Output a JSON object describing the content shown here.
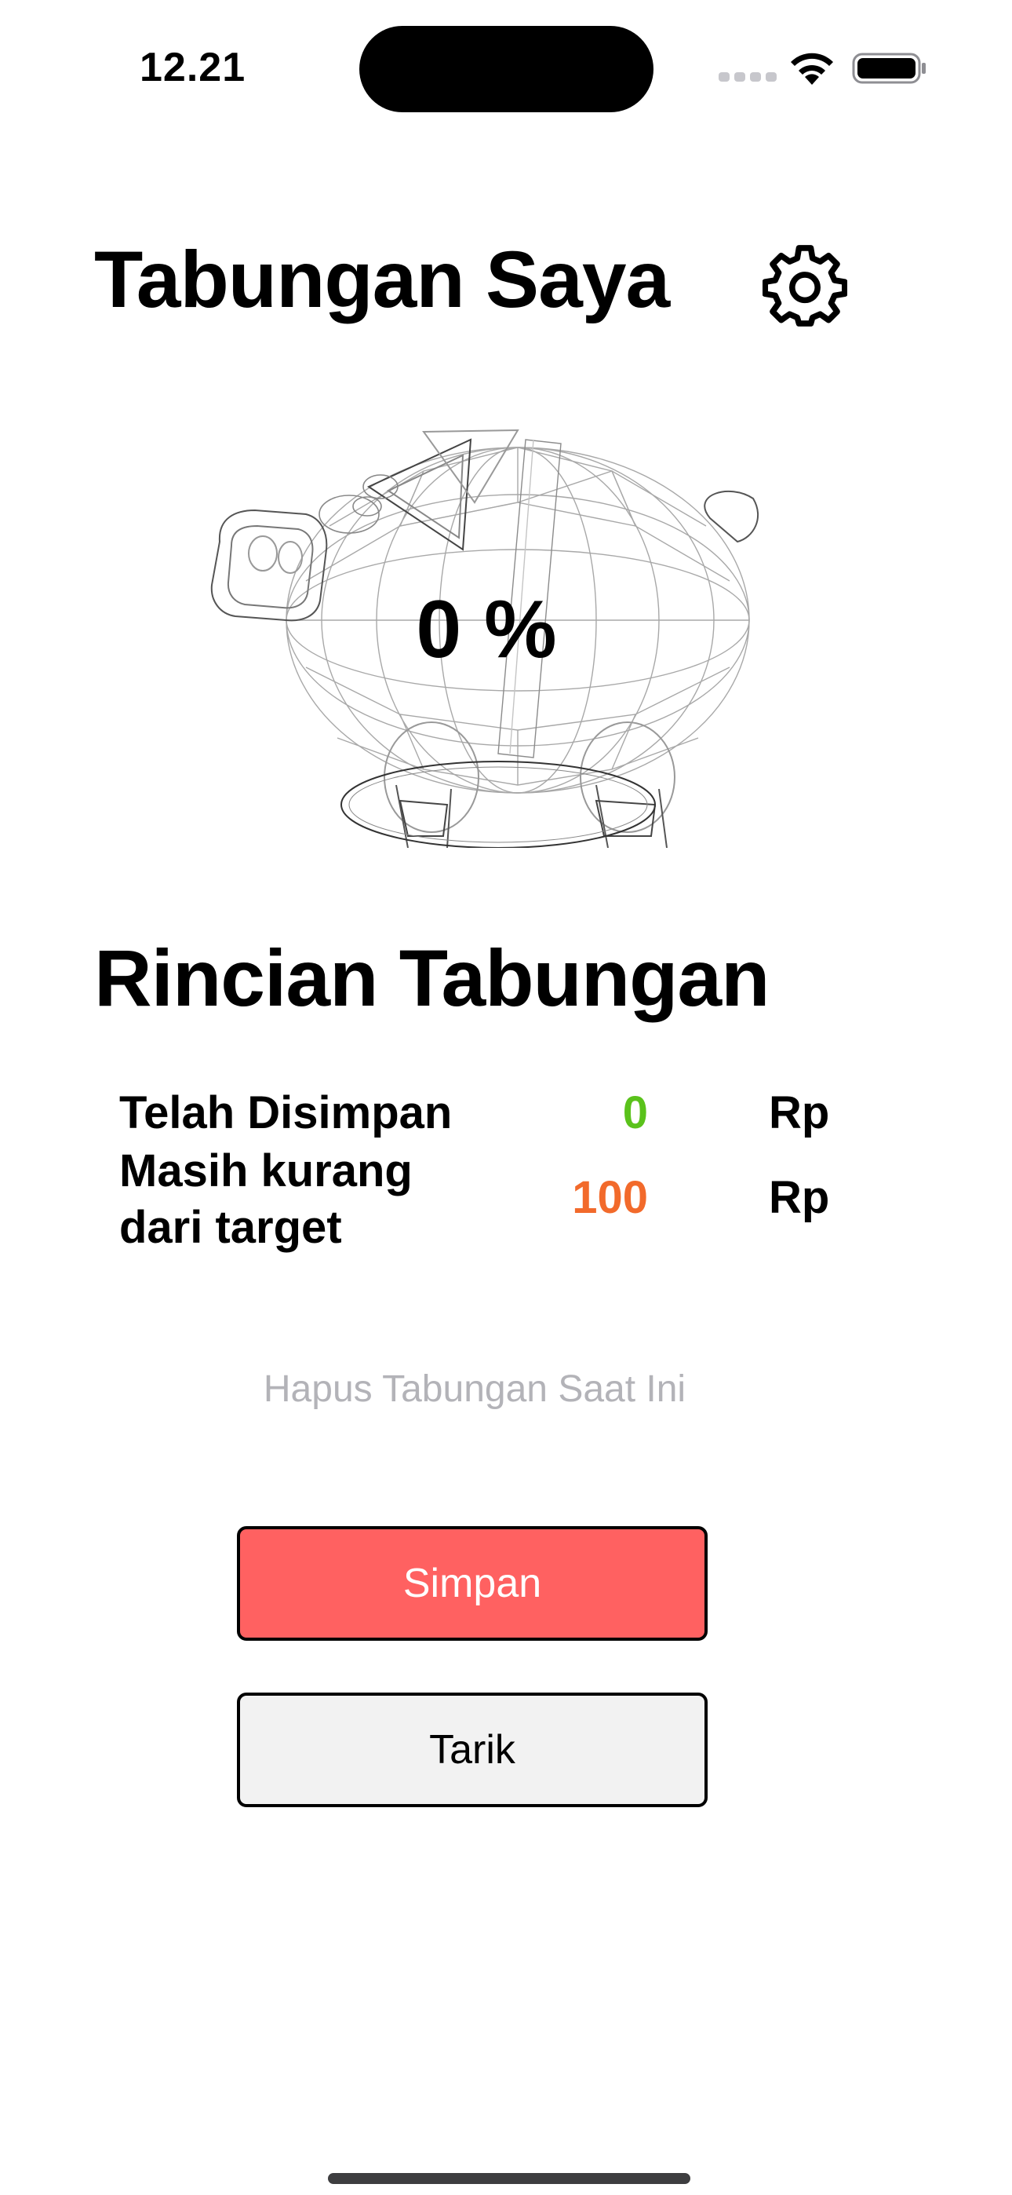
{
  "status_bar": {
    "time": "12.21"
  },
  "header": {
    "title": "Tabungan Saya",
    "settings_icon": "gear-icon"
  },
  "progress": {
    "percent_label": "0 %",
    "fraction": 0
  },
  "details": {
    "title": "Rincian Tabungan",
    "rows": [
      {
        "label": "Telah Disimpan",
        "value": "0",
        "currency": "Rp",
        "color": "#5ac21b"
      },
      {
        "label": "Masih kurang dari target",
        "value": "100",
        "currency": "Rp",
        "color": "#f26a2b"
      }
    ]
  },
  "actions": {
    "reset_label": "Hapus Tabungan Saat Ini",
    "save_label": "Simpan",
    "withdraw_label": "Tarik"
  },
  "colors": {
    "save_button": "#ff6161",
    "withdraw_button": "#f2f2f2",
    "reset_text": "#b3b3b8"
  }
}
